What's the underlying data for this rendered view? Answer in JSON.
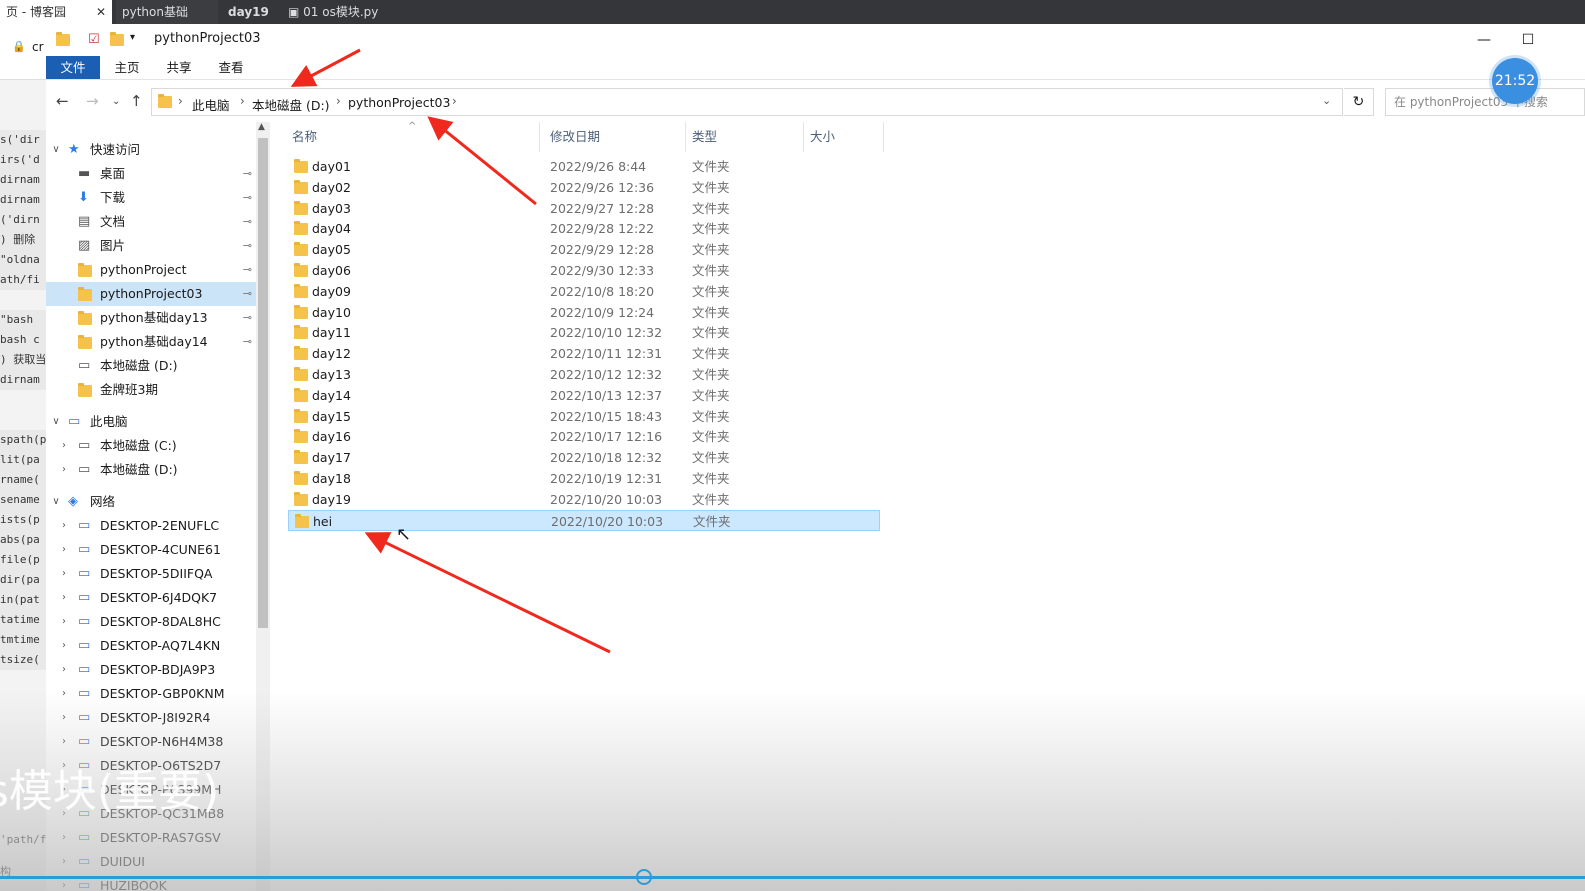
{
  "browser_tabs": [
    {
      "label": "页 - 博客园",
      "close": "✕"
    },
    {
      "label": "python基础"
    },
    {
      "label": "day19"
    },
    {
      "label": "01 os模块.py"
    }
  ],
  "left_editor": {
    "url_prefix": "cr",
    "lines": [
      "s('dir",
      "irs('d",
      "dirnam",
      "dirnam",
      "('dirn",
      ")  删除",
      "\"oldna",
      "ath/fi",
      "\"bash ",
      "bash c",
      ") 获取当",
      "dirnam",
      "spath(p",
      "lit(pa",
      "rname(",
      "sename",
      "ists(p",
      "abs(pa",
      "file(p",
      "dir(pa",
      "in(pat",
      "tatime",
      "tmtime",
      "tsize("
    ],
    "bottom_lines": [
      "'path/fil",
      "构"
    ]
  },
  "explorer": {
    "title": "pythonProject03",
    "window_buttons": {
      "minimize": "—",
      "maximize": "☐"
    },
    "ribbon_tabs": [
      "文件",
      "主页",
      "共享",
      "查看"
    ],
    "address": {
      "crumbs": [
        "此电脑",
        "本地磁盘 (D:)",
        "pythonProject03"
      ],
      "search_placeholder": "在 pythonProject03 中搜索"
    },
    "nav": {
      "quick_access": "快速访问",
      "quick_items": [
        {
          "label": "桌面",
          "icon": "desktop-icon"
        },
        {
          "label": "下载",
          "icon": "download-icon"
        },
        {
          "label": "文档",
          "icon": "documents-icon"
        },
        {
          "label": "图片",
          "icon": "pictures-icon"
        },
        {
          "label": "pythonProject",
          "icon": "folder-icon"
        },
        {
          "label": "pythonProject03",
          "icon": "folder-icon",
          "selected": true
        },
        {
          "label": "python基础day13",
          "icon": "folder-icon"
        },
        {
          "label": "python基础day14",
          "icon": "folder-icon"
        },
        {
          "label": "本地磁盘 (D:)",
          "icon": "drive-icon"
        },
        {
          "label": "金牌班3期",
          "icon": "folder-icon"
        }
      ],
      "this_pc": "此电脑",
      "pc_items": [
        "本地磁盘 (C:)",
        "本地磁盘 (D:)"
      ],
      "network": "网络",
      "network_items": [
        "DESKTOP-2ENUFLC",
        "DESKTOP-4CUNE61",
        "DESKTOP-5DIIFQA",
        "DESKTOP-6J4DQK7",
        "DESKTOP-8DAL8HC",
        "DESKTOP-AQ7L4KN",
        "DESKTOP-BDJA9P3",
        "DESKTOP-GBP0KNM",
        "DESKTOP-J8I92R4",
        "DESKTOP-N6H4M38",
        "DESKTOP-O6TS2D7",
        "DESKTOP-P6S99MH",
        "DESKTOP-QC31MB8",
        "DESKTOP-RAS7GSV",
        "DUIDUI",
        "HUZIBOOK"
      ]
    },
    "columns": [
      "名称",
      "修改日期",
      "类型",
      "大小"
    ],
    "files": [
      {
        "name": "day01",
        "date": "2022/9/26 8:44",
        "type": "文件夹"
      },
      {
        "name": "day02",
        "date": "2022/9/26 12:36",
        "type": "文件夹"
      },
      {
        "name": "day03",
        "date": "2022/9/27 12:28",
        "type": "文件夹"
      },
      {
        "name": "day04",
        "date": "2022/9/28 12:22",
        "type": "文件夹"
      },
      {
        "name": "day05",
        "date": "2022/9/29 12:28",
        "type": "文件夹"
      },
      {
        "name": "day06",
        "date": "2022/9/30 12:33",
        "type": "文件夹"
      },
      {
        "name": "day09",
        "date": "2022/10/8 18:20",
        "type": "文件夹"
      },
      {
        "name": "day10",
        "date": "2022/10/9 12:24",
        "type": "文件夹"
      },
      {
        "name": "day11",
        "date": "2022/10/10 12:32",
        "type": "文件夹"
      },
      {
        "name": "day12",
        "date": "2022/10/11 12:31",
        "type": "文件夹"
      },
      {
        "name": "day13",
        "date": "2022/10/12 12:32",
        "type": "文件夹"
      },
      {
        "name": "day14",
        "date": "2022/10/13 12:37",
        "type": "文件夹"
      },
      {
        "name": "day15",
        "date": "2022/10/15 18:43",
        "type": "文件夹"
      },
      {
        "name": "day16",
        "date": "2022/10/17 12:16",
        "type": "文件夹"
      },
      {
        "name": "day17",
        "date": "2022/10/18 12:32",
        "type": "文件夹"
      },
      {
        "name": "day18",
        "date": "2022/10/19 12:31",
        "type": "文件夹"
      },
      {
        "name": "day19",
        "date": "2022/10/20 10:03",
        "type": "文件夹"
      },
      {
        "name": "hei",
        "date": "2022/10/20 10:03",
        "type": "文件夹",
        "selected": true
      }
    ]
  },
  "overlay": {
    "subtitle": "s模块(重要)",
    "clock": "21:52"
  },
  "colors": {
    "accent": "#1a5fb4",
    "annotation_arrow": "#f0291e",
    "selection": "#cce8ff",
    "folder": "#f5c34c"
  }
}
